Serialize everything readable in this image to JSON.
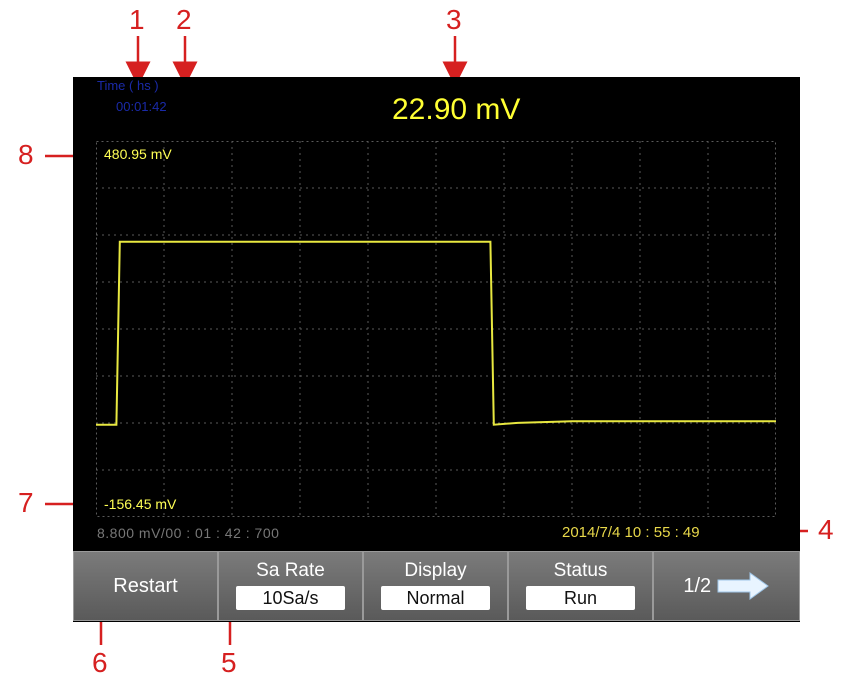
{
  "header": {
    "time_label": "Time ( hs )",
    "time_value": "00:01:42",
    "reading": "22.90 mV"
  },
  "plot": {
    "y_max_label": "480.95 mV",
    "y_min_label": "-156.45 mV",
    "trace_color": "#e8e840",
    "grid_color": "#5a5a5a"
  },
  "chart_data": {
    "type": "line",
    "y_range": [
      -156.45,
      480.95
    ],
    "y_unit": "mV",
    "series": [
      {
        "values": [
          [
            0,
            0
          ],
          [
            0.03,
            0
          ],
          [
            0.035,
            310
          ],
          [
            0.58,
            310
          ],
          [
            0.585,
            0
          ],
          [
            0.62,
            3
          ],
          [
            0.7,
            6
          ],
          [
            1.0,
            6
          ]
        ]
      }
    ]
  },
  "status": {
    "scale": "8.800 mV/00 : 01 : 42 : 700",
    "datetime": "2014/7/4  10 : 55 : 49"
  },
  "buttons": {
    "restart": "Restart",
    "sa_rate_title": "Sa Rate",
    "sa_rate_value": "10Sa/s",
    "display_title": "Display",
    "display_value": "Normal",
    "status_title": "Status",
    "status_value": "Run",
    "page": "1/2"
  },
  "callouts": [
    "1",
    "2",
    "3",
    "4",
    "5",
    "6",
    "7",
    "8"
  ],
  "colors": {
    "callout": "#d62020",
    "reading": "#ffff33",
    "time": "#1a2aa8"
  }
}
